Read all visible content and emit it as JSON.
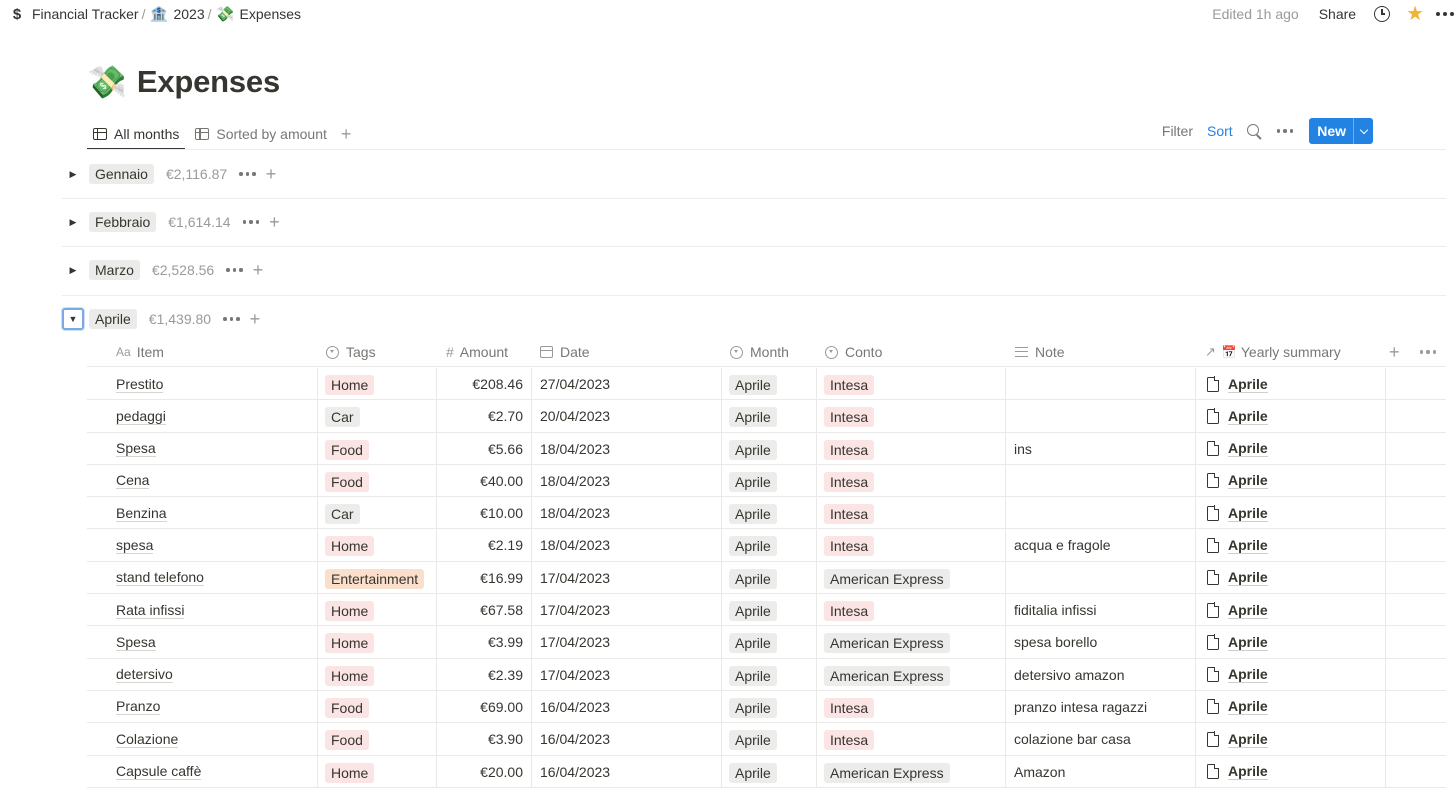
{
  "breadcrumb": {
    "items": [
      {
        "icon": "dollar-icon",
        "glyph": "$",
        "label": "Financial Tracker"
      },
      {
        "icon": "bank-icon",
        "glyph": "🏦",
        "label": "2023"
      },
      {
        "icon": "money-with-wings-icon",
        "glyph": "💸",
        "label": "Expenses"
      }
    ]
  },
  "topbar": {
    "edited": "Edited 1h ago",
    "share": "Share"
  },
  "page": {
    "emoji": "💸",
    "title": "Expenses"
  },
  "views": {
    "tabs": [
      {
        "label": "All months",
        "active": true
      },
      {
        "label": "Sorted by amount",
        "active": false
      }
    ]
  },
  "toolbar": {
    "filter": "Filter",
    "sort": "Sort",
    "new": "New"
  },
  "groups": [
    {
      "name": "Gennaio",
      "sum": "€2,116.87",
      "expanded": false
    },
    {
      "name": "Febbraio",
      "sum": "€1,614.14",
      "expanded": false
    },
    {
      "name": "Marzo",
      "sum": "€2,528.56",
      "expanded": false
    },
    {
      "name": "Aprile",
      "sum": "€1,439.80",
      "expanded": true
    }
  ],
  "table": {
    "columns": [
      "Item",
      "Tags",
      "Amount",
      "Date",
      "Month",
      "Conto",
      "Note",
      "Yearly summary"
    ],
    "column_icons": {
      "Item": "Aa",
      "Amount": "#"
    },
    "rows": [
      {
        "item": "Prestito",
        "tag": "Home",
        "amount": "€208.46",
        "date": "27/04/2023",
        "month": "Aprile",
        "conto": "Intesa",
        "note": "",
        "yearly": "Aprile"
      },
      {
        "item": "pedaggi",
        "tag": "Car",
        "amount": "€2.70",
        "date": "20/04/2023",
        "month": "Aprile",
        "conto": "Intesa",
        "note": "",
        "yearly": "Aprile"
      },
      {
        "item": "Spesa",
        "tag": "Food",
        "amount": "€5.66",
        "date": "18/04/2023",
        "month": "Aprile",
        "conto": "Intesa",
        "note": "ins",
        "yearly": "Aprile"
      },
      {
        "item": "Cena",
        "tag": "Food",
        "amount": "€40.00",
        "date": "18/04/2023",
        "month": "Aprile",
        "conto": "Intesa",
        "note": "",
        "yearly": "Aprile"
      },
      {
        "item": "Benzina",
        "tag": "Car",
        "amount": "€10.00",
        "date": "18/04/2023",
        "month": "Aprile",
        "conto": "Intesa",
        "note": "",
        "yearly": "Aprile"
      },
      {
        "item": "spesa",
        "tag": "Home",
        "amount": "€2.19",
        "date": "18/04/2023",
        "month": "Aprile",
        "conto": "Intesa",
        "note": "acqua e fragole",
        "yearly": "Aprile"
      },
      {
        "item": "stand telefono",
        "tag": "Entertainment",
        "amount": "€16.99",
        "date": "17/04/2023",
        "month": "Aprile",
        "conto": "American Express",
        "note": "",
        "yearly": "Aprile"
      },
      {
        "item": "Rata infissi",
        "tag": "Home",
        "amount": "€67.58",
        "date": "17/04/2023",
        "month": "Aprile",
        "conto": "Intesa",
        "note": "fiditalia infissi",
        "yearly": "Aprile"
      },
      {
        "item": "Spesa",
        "tag": "Home",
        "amount": "€3.99",
        "date": "17/04/2023",
        "month": "Aprile",
        "conto": "American Express",
        "note": "spesa borello",
        "yearly": "Aprile"
      },
      {
        "item": "detersivo",
        "tag": "Home",
        "amount": "€2.39",
        "date": "17/04/2023",
        "month": "Aprile",
        "conto": "American Express",
        "note": "detersivo amazon",
        "yearly": "Aprile"
      },
      {
        "item": "Pranzo",
        "tag": "Food",
        "amount": "€69.00",
        "date": "16/04/2023",
        "month": "Aprile",
        "conto": "Intesa",
        "note": "pranzo intesa ragazzi",
        "yearly": "Aprile"
      },
      {
        "item": "Colazione",
        "tag": "Food",
        "amount": "€3.90",
        "date": "16/04/2023",
        "month": "Aprile",
        "conto": "Intesa",
        "note": "colazione bar casa",
        "yearly": "Aprile"
      },
      {
        "item": "Capsule caffè",
        "tag": "Home",
        "amount": "€20.00",
        "date": "16/04/2023",
        "month": "Aprile",
        "conto": "American Express",
        "note": "Amazon",
        "yearly": "Aprile"
      }
    ]
  },
  "colors": {
    "tag_home": "#fbe4e4",
    "tag_car": "#ececeb",
    "tag_food": "#fbe4e4",
    "tag_entertainment": "#fbdfcd",
    "month_pill": "#ececeb",
    "conto_intesa": "#fbe4e4",
    "conto_amex": "#ececeb",
    "accent": "#2383e2"
  }
}
